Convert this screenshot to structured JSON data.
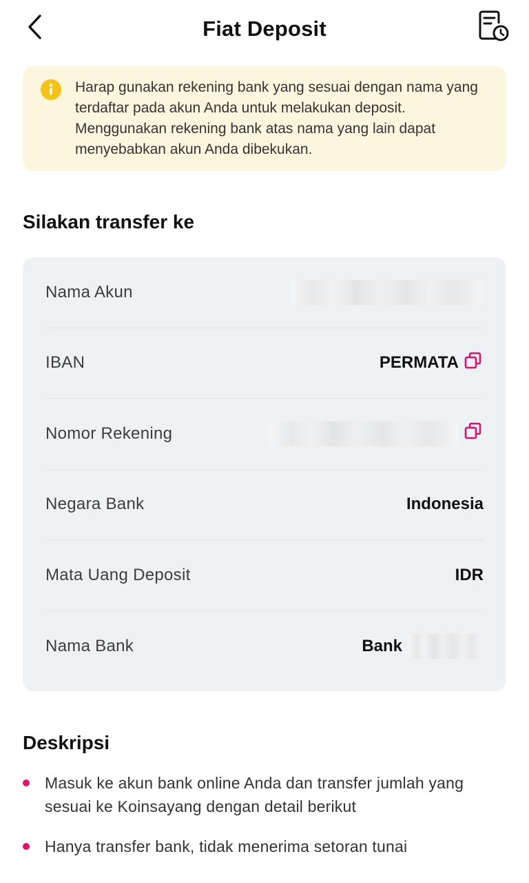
{
  "header": {
    "title": "Fiat Deposit",
    "back_icon": "chevron-left-icon",
    "history_icon": "document-clock-icon"
  },
  "notice": {
    "icon": "info-icon",
    "text": "Harap gunakan rekening bank yang sesuai dengan nama yang terdaftar pada akun Anda untuk melakukan deposit. Menggunakan rekening bank atas nama yang lain dapat menyebabkan akun Anda dibekukan."
  },
  "transfer": {
    "title": "Silakan transfer ke",
    "rows": [
      {
        "label": "Nama Akun",
        "value": ""
      },
      {
        "label": "IBAN",
        "value": "PERMATA"
      },
      {
        "label": "Nomor Rekening",
        "value": ""
      },
      {
        "label": "Negara Bank",
        "value": "Indonesia"
      },
      {
        "label": "Mata Uang Deposit",
        "value": "IDR"
      },
      {
        "label": "Nama Bank",
        "value": "Bank"
      }
    ]
  },
  "description": {
    "title": "Deskripsi",
    "items": [
      "Masuk ke akun bank online Anda dan transfer jumlah yang sesuai ke Koinsayang dengan detail berikut",
      "Hanya transfer bank, tidak menerima setoran tunai"
    ]
  },
  "colors": {
    "accent": "#e0106e",
    "notice_bg": "#fdf6de",
    "notice_icon": "#f5c218",
    "card_bg": "#eff2f4"
  }
}
